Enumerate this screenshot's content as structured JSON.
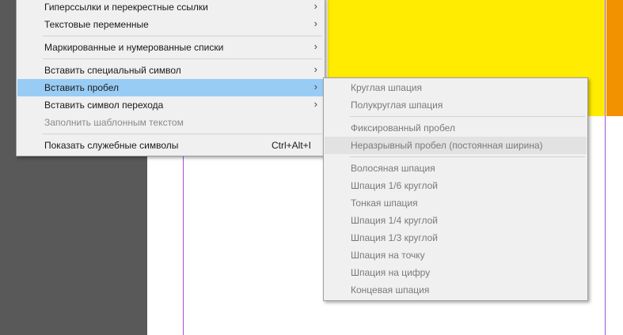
{
  "main_menu": {
    "items": [
      {
        "label": "Гиперссылки и перекрестные ссылки",
        "arrow": "›"
      },
      {
        "label": "Текстовые переменные",
        "arrow": "›"
      },
      {
        "label": "Маркированные и нумерованные списки",
        "arrow": "›"
      },
      {
        "label": "Вставить специальный символ",
        "arrow": "›"
      },
      {
        "label": "Вставить пробел",
        "arrow": "›"
      },
      {
        "label": "Вставить символ перехода",
        "arrow": "›"
      },
      {
        "label": "Заполнить шаблонным текстом"
      },
      {
        "label": "Показать служебные символы",
        "shortcut": "Ctrl+Alt+I"
      }
    ]
  },
  "submenu": {
    "items": [
      {
        "label": "Круглая шпация"
      },
      {
        "label": "Полукруглая шпация"
      },
      {
        "label": "Фиксированный пробел"
      },
      {
        "label": "Неразрывный пробел (постоянная ширина)"
      },
      {
        "label": "Волосяная шпация"
      },
      {
        "label": "Шпация 1/6 круглой"
      },
      {
        "label": "Тонкая шпация"
      },
      {
        "label": "Шпация 1/4 круглой"
      },
      {
        "label": "Шпация 1/3 круглой"
      },
      {
        "label": "Шпация на точку"
      },
      {
        "label": "Шпация на цифру"
      },
      {
        "label": "Концевая шпация"
      }
    ]
  },
  "colors": {
    "highlight": "#99ccf5",
    "yellow": "#ffec00",
    "orange": "#f39200",
    "guide": "#a64bd9"
  }
}
